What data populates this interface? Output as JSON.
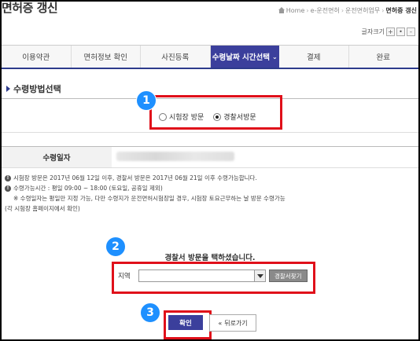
{
  "header": {
    "title": "면허증 갱신",
    "breadcrumb": [
      "Home",
      "e-운전면허",
      "운전면허업무",
      "면허증 갱신"
    ]
  },
  "font_size": {
    "label": "글자크기",
    "increase": "+",
    "reset": "•",
    "decrease": "-"
  },
  "tabs": [
    {
      "label": "이용약관"
    },
    {
      "label": "면허정보 확인"
    },
    {
      "label": "사진등록"
    },
    {
      "label": "수령날짜 시간선택",
      "active": true
    },
    {
      "label": "결제"
    },
    {
      "label": "완료"
    }
  ],
  "section": {
    "title": "수령방법선택"
  },
  "receive_method": {
    "options": [
      "시험장 방문",
      "경찰서방문"
    ],
    "selected": "경찰서방문"
  },
  "receive_date": {
    "label": "수령일자"
  },
  "notes": [
    "시험장 방문은 2017년 06월 12일 이후, 경찰서 방문은 2017년 06월 21일 이후 수령가능합니다.",
    "수령가능시간 : 평일 09:00 ~ 18:00 (토요일, 공휴일 제외)",
    "※ 수령일자는 평일만 지정 가능, 다만 수령지가 운전면허시험장일 경우, 시험장 토요근무하는 날 방문 수령가능",
    "(각 시험장 홈페이지에서 확인)"
  ],
  "police_visit": {
    "title": "경찰서 방문을 택하셨습니다.",
    "region_label": "지역",
    "region_value": "",
    "find_button": "경찰서찾기"
  },
  "actions": {
    "confirm": "확인",
    "back": "뒤로가기",
    "back_prefix": "«"
  },
  "annotations": {
    "step1": "1",
    "step2": "2",
    "step3": "3",
    "badge_color": "#1e90ff",
    "highlight_color": "#e0101a"
  },
  "colors": {
    "accent": "#3b3f9c",
    "tab_border": "#2e3b8c"
  }
}
